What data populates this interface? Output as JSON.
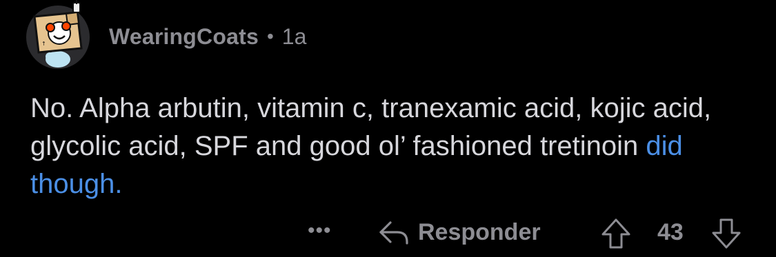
{
  "comment": {
    "author": "WearingCoats",
    "separator": "•",
    "age": "1a",
    "text_parts": [
      "No. Alpha arbutin, vitamin c, tranexamic acid, kojic acid, glycolic acid, SPF and good ol’ fashioned tretinoin ",
      "did though."
    ]
  },
  "actions": {
    "more_label": "•••",
    "reply_label": "Responder",
    "score": "43",
    "reply_icon": "reply-arrow-icon",
    "upvote_icon": "upvote-arrow-icon",
    "downvote_icon": "downvote-arrow-icon"
  },
  "colors": {
    "background": "#000000",
    "text": "#d7d7dc",
    "muted": "#8d8d93",
    "link": "#4b8fe6"
  }
}
